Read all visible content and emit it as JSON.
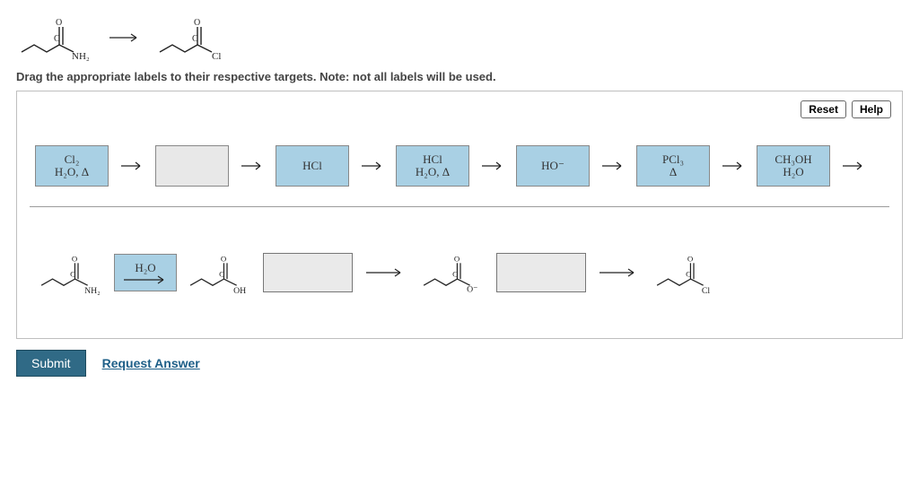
{
  "reaction_header": {
    "reactant_label": "NH₂",
    "product_label": "Cl"
  },
  "prompt": "Drag the appropriate labels to their respective targets. Note: not all labels will be used.",
  "buttons": {
    "reset": "Reset",
    "help": "Help",
    "submit": "Submit",
    "request": "Request Answer"
  },
  "pool": [
    {
      "line1": "Cl₂",
      "line2": "H₂O, Δ",
      "kind": "blue"
    },
    {
      "line1": "",
      "line2": "",
      "kind": "gray"
    },
    {
      "line1": "HCl",
      "line2": "",
      "kind": "blue"
    },
    {
      "line1": "HCl",
      "line2": "H₂O, Δ",
      "kind": "blue"
    },
    {
      "line1": "HO⁻",
      "line2": "",
      "kind": "blue"
    },
    {
      "line1": "PCl₃",
      "line2": "Δ",
      "kind": "blue"
    },
    {
      "line1": "CH₃OH",
      "line2": "H₂O",
      "kind": "blue"
    }
  ],
  "targets": [
    {
      "mol": "amide",
      "mol_label": "NH₂",
      "arrow_filled": true,
      "arrow_label": "H₂O"
    },
    {
      "mol": "acid",
      "mol_label": "OH",
      "arrow_filled": false,
      "arrow_label": ""
    },
    {
      "mol": "carboxylate",
      "mol_label": "O⁻",
      "arrow_filled": false,
      "arrow_label": ""
    },
    {
      "mol": "acyl-cl",
      "mol_label": "Cl",
      "arrow_filled": false,
      "arrow_label": ""
    }
  ]
}
